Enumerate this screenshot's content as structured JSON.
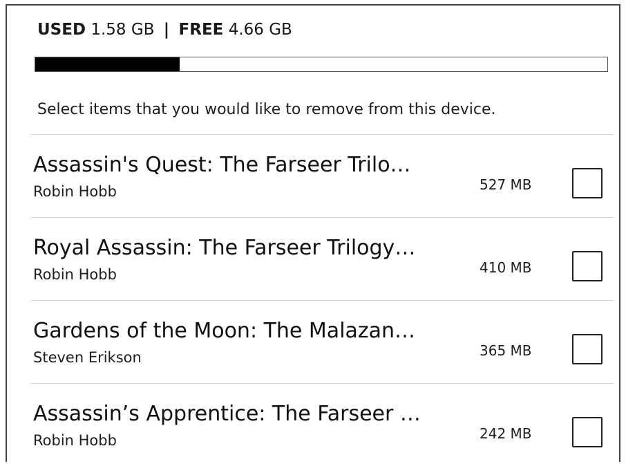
{
  "storage": {
    "used_label": "USED",
    "used_value": "1.58 GB",
    "separator": "|",
    "free_label": "FREE",
    "free_value": "4.66 GB",
    "used_fraction": 0.253
  },
  "instruction": "Select items that you would like to remove from this device.",
  "items": [
    {
      "title": "Assassin's Quest: The Farseer Trilo…",
      "author": "Robin Hobb",
      "size": "527 MB",
      "checked": false
    },
    {
      "title": "Royal Assassin: The Farseer Trilogy…",
      "author": "Robin Hobb",
      "size": "410 MB",
      "checked": false
    },
    {
      "title": "Gardens of the Moon: The Malazan…",
      "author": "Steven Erikson",
      "size": "365 MB",
      "checked": false
    },
    {
      "title": "Assassin’s Apprentice: The Farseer …",
      "author": "Robin Hobb",
      "size": "242 MB",
      "checked": false
    }
  ]
}
